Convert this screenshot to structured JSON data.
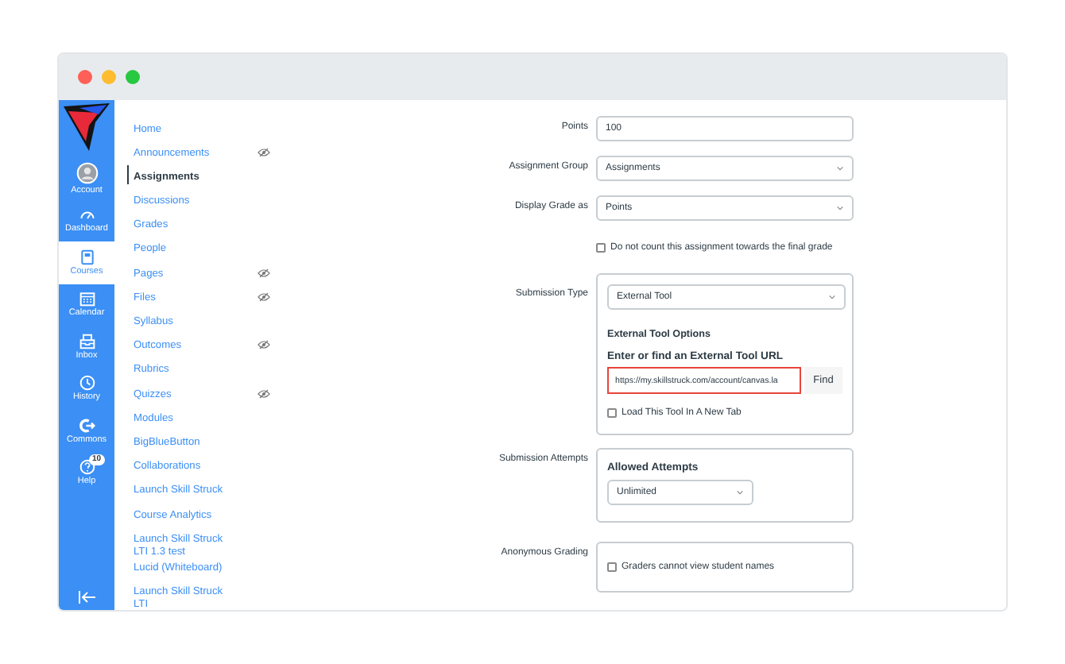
{
  "global_nav": [
    {
      "kind": "account",
      "label": "Account",
      "selected": false
    },
    {
      "kind": "dashboard",
      "label": "Dashboard",
      "selected": false
    },
    {
      "kind": "courses",
      "label": "Courses",
      "selected": true
    },
    {
      "kind": "calendar",
      "label": "Calendar",
      "selected": false
    },
    {
      "kind": "inbox",
      "label": "Inbox",
      "selected": false
    },
    {
      "kind": "history",
      "label": "History",
      "selected": false
    },
    {
      "kind": "commons",
      "label": "Commons",
      "selected": false
    },
    {
      "kind": "help",
      "label": "Help",
      "selected": false,
      "badge": "10"
    }
  ],
  "course_nav": [
    {
      "label": "Home",
      "selected": false,
      "hidden": false
    },
    {
      "label": "Announcements",
      "selected": false,
      "hidden": true
    },
    {
      "label": "Assignments",
      "selected": true,
      "hidden": false
    },
    {
      "label": "Discussions",
      "selected": false,
      "hidden": false
    },
    {
      "label": "Grades",
      "selected": false,
      "hidden": false
    },
    {
      "label": "People",
      "selected": false,
      "hidden": false
    },
    {
      "label": "Pages",
      "selected": false,
      "hidden": true
    },
    {
      "label": "Files",
      "selected": false,
      "hidden": true
    },
    {
      "label": "Syllabus",
      "selected": false,
      "hidden": false
    },
    {
      "label": "Outcomes",
      "selected": false,
      "hidden": true
    },
    {
      "label": "Rubrics",
      "selected": false,
      "hidden": false
    },
    {
      "label": "Quizzes",
      "selected": false,
      "hidden": true
    },
    {
      "label": "Modules",
      "selected": false,
      "hidden": false
    },
    {
      "label": "BigBlueButton",
      "selected": false,
      "hidden": false
    },
    {
      "label": "Collaborations",
      "selected": false,
      "hidden": false
    },
    {
      "label": "Launch Skill Struck",
      "selected": false,
      "hidden": false
    },
    {
      "label": "Course Analytics",
      "selected": false,
      "hidden": false
    },
    {
      "label": "Launch Skill Struck LTI 1.3 test",
      "selected": false,
      "hidden": false
    },
    {
      "label": "Lucid (Whiteboard)",
      "selected": false,
      "hidden": false
    },
    {
      "label": "Launch Skill Struck LTI",
      "selected": false,
      "hidden": false
    }
  ],
  "form": {
    "points": {
      "label": "Points",
      "value": "100"
    },
    "assignment_group": {
      "label": "Assignment Group",
      "value": "Assignments"
    },
    "display_grade": {
      "label": "Display Grade as",
      "value": "Points"
    },
    "exclude_checkbox": {
      "label": "Do not count this assignment towards the final grade",
      "checked": false
    },
    "submission_type": {
      "label": "Submission Type",
      "value": "External Tool",
      "options_title": "External Tool Options",
      "url_label": "Enter or find an External Tool URL",
      "url_value": "https://my.skillstruck.com/account/canvas.la",
      "find_button": "Find",
      "new_tab": {
        "label": "Load This Tool In A New Tab",
        "checked": false
      }
    },
    "submission_attempts": {
      "label": "Submission Attempts",
      "title": "Allowed Attempts",
      "value": "Unlimited"
    },
    "anonymous_grading": {
      "label": "Anonymous Grading",
      "checkbox": {
        "label": "Graders cannot view student names",
        "checked": false
      }
    }
  }
}
